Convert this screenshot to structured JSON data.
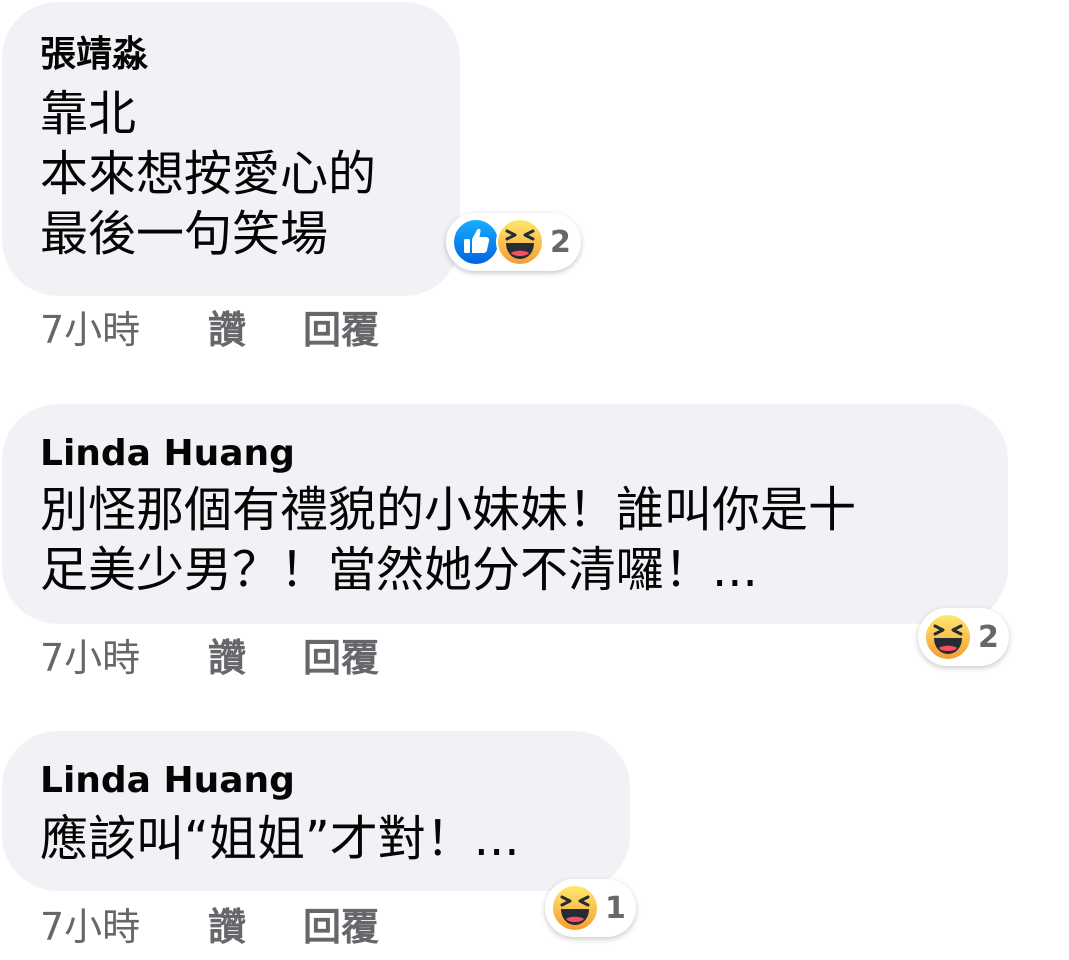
{
  "comments": [
    {
      "author": "張靖淼",
      "lines": [
        "靠北",
        "本來想按愛心的",
        "最後一句笑場"
      ],
      "time": "7小時",
      "like_label": "讚",
      "reply_label": "回覆",
      "reactions": [
        "like",
        "haha"
      ],
      "reaction_count": "2"
    },
    {
      "author": "Linda Huang",
      "lines": [
        "別怪那個有禮貌的小妹妹！誰叫你是十",
        "足美少男？！當然她分不清囉！..."
      ],
      "time": "7小時",
      "like_label": "讚",
      "reply_label": "回覆",
      "reactions": [
        "haha"
      ],
      "reaction_count": "2"
    },
    {
      "author": "Linda Huang",
      "lines": [
        "應該叫“姐姐”才對！..."
      ],
      "time": "7小時",
      "like_label": "讚",
      "reply_label": "回覆",
      "reactions": [
        "haha"
      ],
      "reaction_count": "1"
    }
  ],
  "colors": {
    "bubble": "#f0f2f5",
    "meta_text": "#65676b",
    "like_blue": "#1877f2",
    "haha_yellow": "#f7b928"
  },
  "icons": {
    "like": "thumbs-up-icon",
    "haha": "laughing-face-icon"
  }
}
